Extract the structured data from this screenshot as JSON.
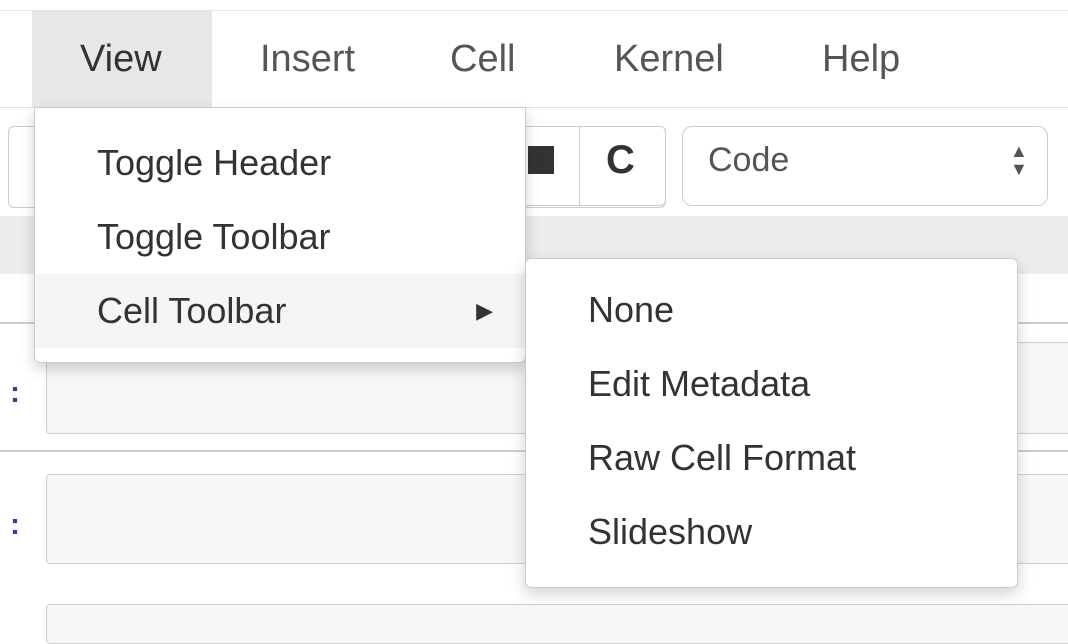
{
  "menubar": {
    "items": [
      {
        "label": "View"
      },
      {
        "label": "Insert"
      },
      {
        "label": "Cell"
      },
      {
        "label": "Kernel"
      },
      {
        "label": "Help"
      }
    ]
  },
  "toolbar": {
    "stop_icon": "stop-icon",
    "restart_icon": "restart-icon",
    "restart_glyph": "C",
    "cell_type": "Code",
    "cell_type_arrows": "▲▼"
  },
  "notebook": {
    "prompt": ":"
  },
  "view_menu": {
    "items": [
      {
        "label": "Toggle Header"
      },
      {
        "label": "Toggle Toolbar"
      },
      {
        "label": "Cell Toolbar",
        "has_submenu": true
      }
    ],
    "submenu_caret": "▶"
  },
  "cell_toolbar_submenu": {
    "items": [
      {
        "label": "None"
      },
      {
        "label": "Edit Metadata"
      },
      {
        "label": "Raw Cell Format"
      },
      {
        "label": "Slideshow"
      }
    ]
  },
  "colors": {
    "menu_active_bg": "#e7e7e7",
    "prompt_color": "#303f9f"
  }
}
